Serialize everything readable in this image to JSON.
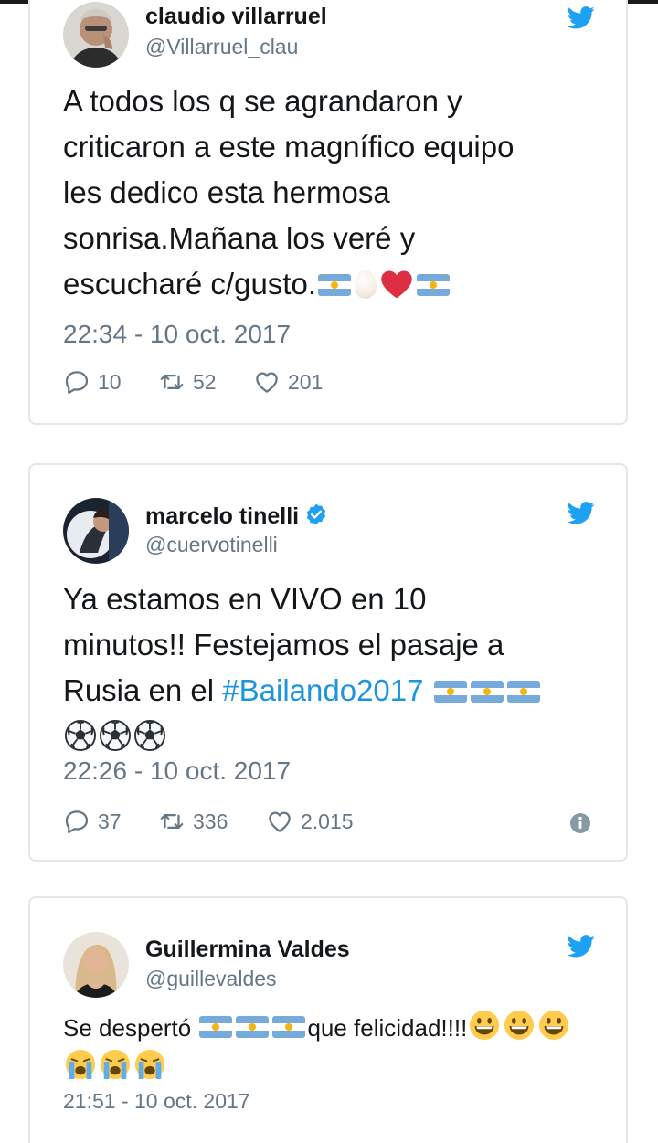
{
  "tweets": [
    {
      "name": "claudio villarruel",
      "handle": "@Villarruel_clau",
      "text_lines": [
        "A todos los q se agrandaron y",
        "criticaron a este magnífico equipo",
        "les dedico esta hermosa",
        "sonrisa.Mañana los veré y",
        "escucharé c/gusto."
      ],
      "timestamp": "22:34 - 10 oct. 2017",
      "replies": "10",
      "retweets": "52",
      "likes": "201"
    },
    {
      "name": "marcelo tinelli",
      "handle": "@cuervotinelli",
      "text_lines": [
        "Ya estamos en VIVO en 10",
        "minutos!! Festejamos el pasaje a",
        "Rusia en el"
      ],
      "hashtag": "#Bailando2017",
      "timestamp": "22:26 - 10 oct. 2017",
      "replies": "37",
      "retweets": "336",
      "likes": "2.015"
    },
    {
      "name": "Guillermina Valdes",
      "handle": "@guillevaldes",
      "text_before": "Se despertó ",
      "text_after": "que felicidad!!!!",
      "timestamp": "21:51 - 10 oct. 2017"
    }
  ],
  "icons": [
    "twitter-bird-icon",
    "verified-badge-icon",
    "reply-icon",
    "retweet-icon",
    "like-icon",
    "info-icon",
    "argentina-flag-emoji",
    "egg-emoji",
    "heart-emoji",
    "soccer-ball-emoji",
    "grinning-face-emoji",
    "crying-face-emoji"
  ],
  "colors": {
    "twitter_blue": "#1da1f2",
    "link": "#1b95e0",
    "secondary_text": "#657786",
    "border": "#e1e8ed"
  }
}
